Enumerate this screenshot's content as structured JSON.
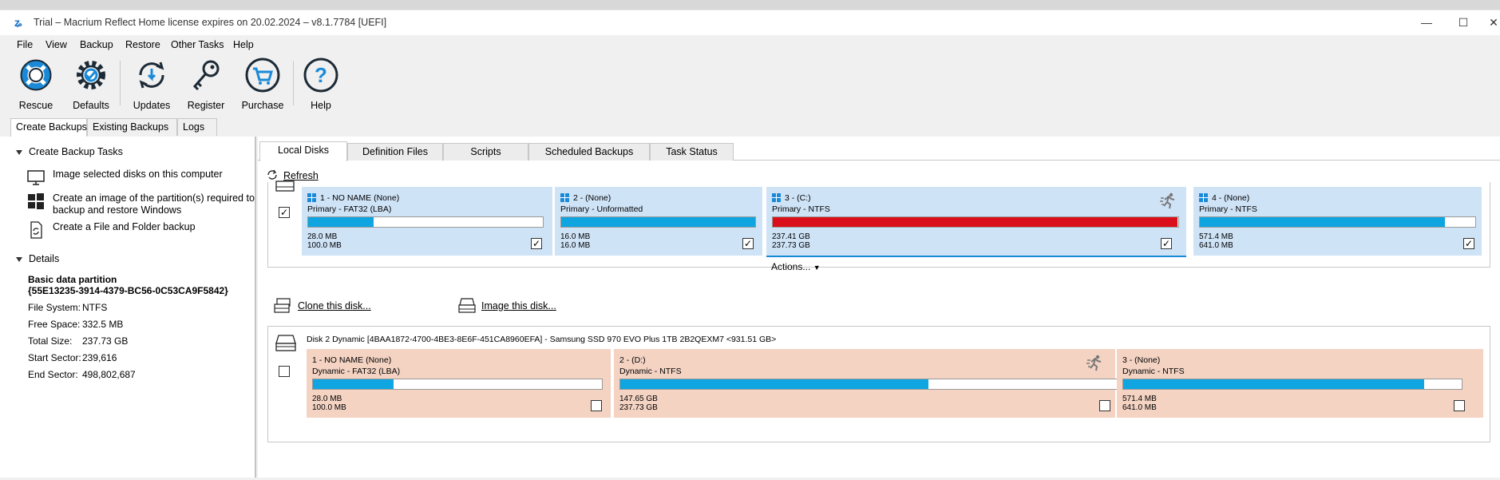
{
  "window": {
    "title": "Trial – Macrium Reflect Home license expires on 20.02.2024 – v8.1.7784  [UEFI]",
    "controls": {
      "minimize": "—",
      "maximize": "☐",
      "close": "✕"
    }
  },
  "menu": [
    "File",
    "View",
    "Backup",
    "Restore",
    "Other Tasks",
    "Help"
  ],
  "toolbar": {
    "rescue": "Rescue",
    "defaults": "Defaults",
    "updates": "Updates",
    "register": "Register",
    "purchase": "Purchase",
    "help": "Help"
  },
  "main_tabs": [
    "Create Backups",
    "Existing Backups",
    "Logs"
  ],
  "left": {
    "tasks_header": "Create Backup Tasks",
    "tasks": [
      {
        "label": "Image selected disks on this computer",
        "icon": "monitor-icon"
      },
      {
        "label": "Create an image of the partition(s) required to backup and restore Windows",
        "icon": "windows-icon"
      },
      {
        "label": "Create a File and Folder backup",
        "icon": "file-backup-icon"
      }
    ],
    "details_header": "Details",
    "details": {
      "name": "Basic data partition",
      "guid": "{55E13235-3914-4379-BC56-0C53CA9F5842}",
      "fs_label": "File System:",
      "fs": "NTFS",
      "free_label": "Free Space:",
      "free": "332.5 MB",
      "total_label": "Total Size:",
      "total": "237.73 GB",
      "start_label": "Start Sector:",
      "start": "239,616",
      "end_label": "End Sector:",
      "end": "498,802,687"
    }
  },
  "right_tabs": [
    "Local Disks",
    "Definition Files",
    "Scripts",
    "Scheduled Backups",
    "Task Status"
  ],
  "refresh": "Refresh",
  "actions": "Actions...",
  "clone": "Clone this disk...",
  "image": "Image this disk...",
  "disk1": {
    "checked": true,
    "partitions": [
      {
        "name": "1 - NO NAME (None)",
        "type": "Primary - FAT32 (LBA)",
        "used": "28.0 MB",
        "size": "100.0 MB",
        "fill": 0.28,
        "color": "#0ea5e0",
        "checked": true
      },
      {
        "name": "2 -  (None)",
        "type": "Primary - Unformatted",
        "used": "16.0 MB",
        "size": "16.0 MB",
        "fill": 1.0,
        "color": "#0ea5e0",
        "checked": true
      },
      {
        "name": "3 -  (C:)",
        "type": "Primary - NTFS",
        "used": "237.41 GB",
        "size": "237.73 GB",
        "fill": 0.998,
        "color": "#d9101b",
        "checked": true
      },
      {
        "name": "4 -  (None)",
        "type": "Primary - NTFS",
        "used": "571.4 MB",
        "size": "641.0 MB",
        "fill": 0.89,
        "color": "#0ea5e0",
        "checked": true
      }
    ]
  },
  "disk2": {
    "title": "Disk 2 Dynamic [4BAA1872-4700-4BE3-8E6F-451CA8960EFA] - Samsung SSD 970 EVO Plus 1TB 2B2QEXM7  <931.51 GB>",
    "checked": false,
    "partitions": [
      {
        "name": "1 - NO NAME (None)",
        "type": "Dynamic - FAT32 (LBA)",
        "used": "28.0 MB",
        "size": "100.0 MB",
        "fill": 0.28,
        "color": "#0ea5e0",
        "checked": false
      },
      {
        "name": "2 -  (D:)",
        "type": "Dynamic - NTFS",
        "used": "147.65 GB",
        "size": "237.73 GB",
        "fill": 0.62,
        "color": "#0ea5e0",
        "checked": false
      },
      {
        "name": "3 -  (None)",
        "type": "Dynamic - NTFS",
        "used": "571.4 MB",
        "size": "641.0 MB",
        "fill": 0.89,
        "color": "#0ea5e0",
        "checked": false
      }
    ]
  },
  "colors": {
    "selected_part": "#cfe3f7",
    "dyn_part": "#f4d3c3",
    "accent": "#0ea5e0",
    "full": "#d9101b"
  }
}
